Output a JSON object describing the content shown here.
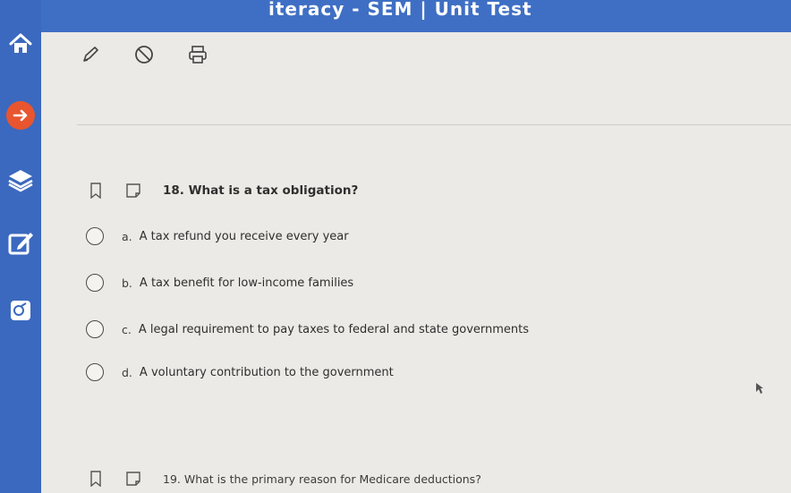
{
  "header": {
    "title": "iteracy - SEM | Unit Test"
  },
  "sidebar": {
    "items": [
      {
        "icon": "home-icon"
      },
      {
        "icon": "arrow-right-icon",
        "color": "#e8552f"
      },
      {
        "icon": "layers-icon"
      },
      {
        "icon": "edit-icon"
      },
      {
        "icon": "calculator-icon"
      }
    ]
  },
  "toolbar": {
    "items": [
      {
        "icon": "pencil-icon"
      },
      {
        "icon": "eliminate-icon"
      },
      {
        "icon": "print-icon"
      }
    ]
  },
  "questions": [
    {
      "text": "18. What is a tax obligation?",
      "options": [
        {
          "letter": "a.",
          "text": "A tax refund you receive every year"
        },
        {
          "letter": "b.",
          "text": "A tax benefit for low-income families"
        },
        {
          "letter": "c.",
          "text": "A legal requirement to pay taxes to federal and state governments"
        },
        {
          "letter": "d.",
          "text": "A voluntary contribution to the government"
        }
      ]
    },
    {
      "text": "19. What is the primary reason for Medicare deductions?"
    }
  ],
  "colors": {
    "sidebar": "#3b69bf",
    "topbar": "#3f6fc4",
    "accent_orange": "#e8552f",
    "background": "#ebeae6"
  }
}
